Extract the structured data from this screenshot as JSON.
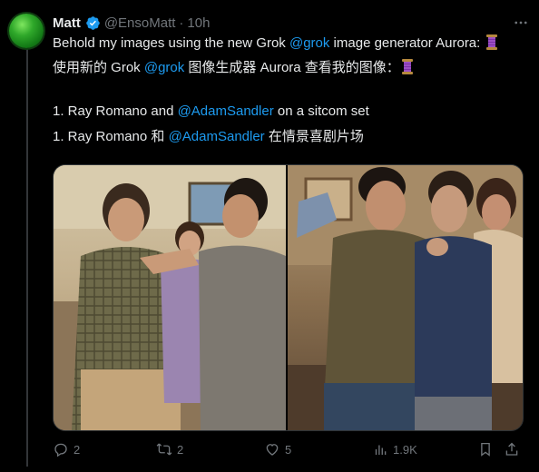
{
  "author": {
    "name": "Matt",
    "handle": "@EnsoMatt",
    "separator": "·",
    "time": "10h",
    "verified": true,
    "avatar_color": "#2fa82a"
  },
  "tweet": {
    "line1_text": "Behold my images using the new Grok ",
    "line1_mention": "@grok",
    "line1_rest": " image generator Aurora: ",
    "line2_text": "使用新的 Grok ",
    "line2_mention": "@grok",
    "line2_rest": " 图像生成器 Aurora 查看我的图像：",
    "line3_text": "1. Ray Romano and ",
    "line3_mention": "@AdamSandler",
    "line3_rest": " on a sitcom set",
    "line4_text": "1. Ray Romano 和 ",
    "line4_mention": "@AdamSandler",
    "line4_rest": " 在情景喜剧片场",
    "emoji": "spool-of-thread"
  },
  "actions": {
    "replies": "2",
    "reposts": "2",
    "likes": "5",
    "views": "1.9K"
  },
  "colors": {
    "background": "#000000",
    "text": "#e7e9ea",
    "muted": "#71767b",
    "link": "#1d9bf0"
  }
}
